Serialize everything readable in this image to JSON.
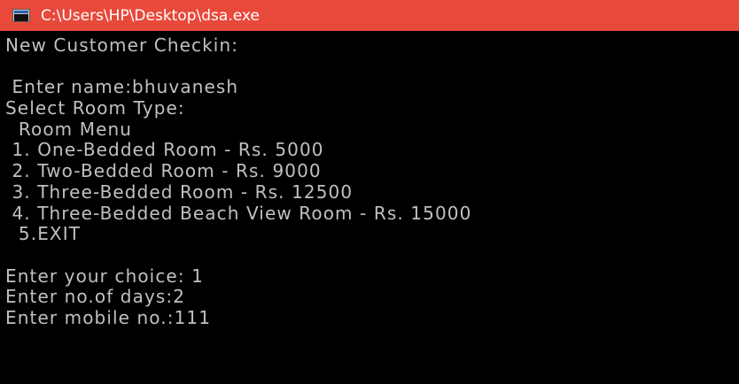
{
  "window": {
    "title": "C:\\Users\\HP\\Desktop\\dsa.exe",
    "title_bar_color": "#e8493a",
    "icon": "console-app-icon"
  },
  "console": {
    "text_color": "#c0c0c0",
    "background": "#000000",
    "lines": [
      "New Customer Checkin:",
      "",
      " Enter name:bhuvanesh",
      "Select Room Type:",
      "  Room Menu",
      " 1. One-Bedded Room - Rs. 5000",
      " 2. Two-Bedded Room - Rs. 9000",
      " 3. Three-Bedded Room - Rs. 12500",
      " 4. Three-Bedded Beach View Room - Rs. 15000",
      "  5.EXIT",
      "",
      "Enter your choice: 1",
      "Enter no.of days:2",
      "Enter mobile no.:111"
    ]
  }
}
